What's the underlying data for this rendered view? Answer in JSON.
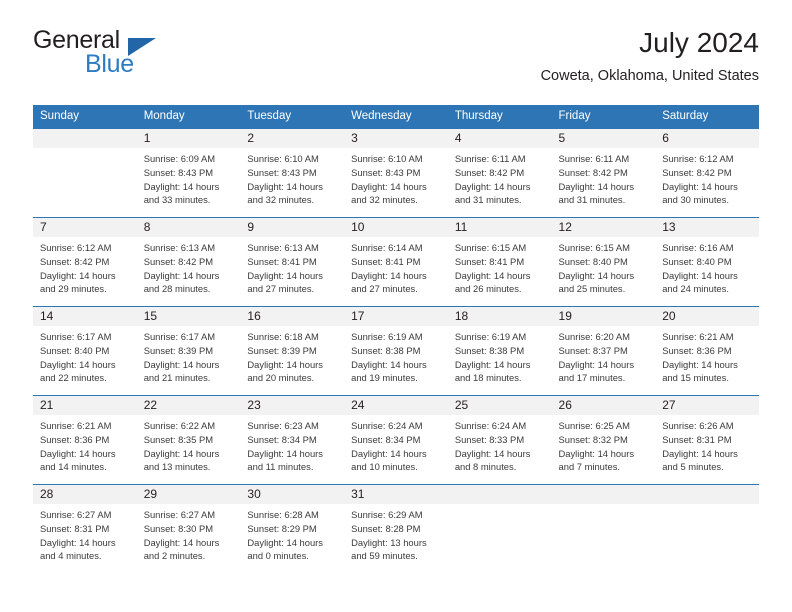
{
  "brand": {
    "name_part1": "General",
    "name_part2": "Blue",
    "triangle_color": "#2266a8",
    "blue_text_color": "#2b7cc2"
  },
  "header": {
    "title": "July 2024",
    "location": "Coweta, Oklahoma, United States"
  },
  "theme": {
    "header_blue": "#2E75B6",
    "daynum_background": "#F2F2F2",
    "text_color": "#231F20"
  },
  "weekday_headers": [
    "Sunday",
    "Monday",
    "Tuesday",
    "Wednesday",
    "Thursday",
    "Friday",
    "Saturday"
  ],
  "labels": {
    "sunrise_prefix": "Sunrise:",
    "sunset_prefix": "Sunset:",
    "daylight_prefix": "Daylight:"
  },
  "weeks": [
    [
      {
        "day": "",
        "sunrise": "",
        "sunset": "",
        "daylight_line1": "",
        "daylight_line2": ""
      },
      {
        "day": "1",
        "sunrise": "Sunrise: 6:09 AM",
        "sunset": "Sunset: 8:43 PM",
        "daylight_line1": "Daylight: 14 hours",
        "daylight_line2": "and 33 minutes."
      },
      {
        "day": "2",
        "sunrise": "Sunrise: 6:10 AM",
        "sunset": "Sunset: 8:43 PM",
        "daylight_line1": "Daylight: 14 hours",
        "daylight_line2": "and 32 minutes."
      },
      {
        "day": "3",
        "sunrise": "Sunrise: 6:10 AM",
        "sunset": "Sunset: 8:43 PM",
        "daylight_line1": "Daylight: 14 hours",
        "daylight_line2": "and 32 minutes."
      },
      {
        "day": "4",
        "sunrise": "Sunrise: 6:11 AM",
        "sunset": "Sunset: 8:42 PM",
        "daylight_line1": "Daylight: 14 hours",
        "daylight_line2": "and 31 minutes."
      },
      {
        "day": "5",
        "sunrise": "Sunrise: 6:11 AM",
        "sunset": "Sunset: 8:42 PM",
        "daylight_line1": "Daylight: 14 hours",
        "daylight_line2": "and 31 minutes."
      },
      {
        "day": "6",
        "sunrise": "Sunrise: 6:12 AM",
        "sunset": "Sunset: 8:42 PM",
        "daylight_line1": "Daylight: 14 hours",
        "daylight_line2": "and 30 minutes."
      }
    ],
    [
      {
        "day": "7",
        "sunrise": "Sunrise: 6:12 AM",
        "sunset": "Sunset: 8:42 PM",
        "daylight_line1": "Daylight: 14 hours",
        "daylight_line2": "and 29 minutes."
      },
      {
        "day": "8",
        "sunrise": "Sunrise: 6:13 AM",
        "sunset": "Sunset: 8:42 PM",
        "daylight_line1": "Daylight: 14 hours",
        "daylight_line2": "and 28 minutes."
      },
      {
        "day": "9",
        "sunrise": "Sunrise: 6:13 AM",
        "sunset": "Sunset: 8:41 PM",
        "daylight_line1": "Daylight: 14 hours",
        "daylight_line2": "and 27 minutes."
      },
      {
        "day": "10",
        "sunrise": "Sunrise: 6:14 AM",
        "sunset": "Sunset: 8:41 PM",
        "daylight_line1": "Daylight: 14 hours",
        "daylight_line2": "and 27 minutes."
      },
      {
        "day": "11",
        "sunrise": "Sunrise: 6:15 AM",
        "sunset": "Sunset: 8:41 PM",
        "daylight_line1": "Daylight: 14 hours",
        "daylight_line2": "and 26 minutes."
      },
      {
        "day": "12",
        "sunrise": "Sunrise: 6:15 AM",
        "sunset": "Sunset: 8:40 PM",
        "daylight_line1": "Daylight: 14 hours",
        "daylight_line2": "and 25 minutes."
      },
      {
        "day": "13",
        "sunrise": "Sunrise: 6:16 AM",
        "sunset": "Sunset: 8:40 PM",
        "daylight_line1": "Daylight: 14 hours",
        "daylight_line2": "and 24 minutes."
      }
    ],
    [
      {
        "day": "14",
        "sunrise": "Sunrise: 6:17 AM",
        "sunset": "Sunset: 8:40 PM",
        "daylight_line1": "Daylight: 14 hours",
        "daylight_line2": "and 22 minutes."
      },
      {
        "day": "15",
        "sunrise": "Sunrise: 6:17 AM",
        "sunset": "Sunset: 8:39 PM",
        "daylight_line1": "Daylight: 14 hours",
        "daylight_line2": "and 21 minutes."
      },
      {
        "day": "16",
        "sunrise": "Sunrise: 6:18 AM",
        "sunset": "Sunset: 8:39 PM",
        "daylight_line1": "Daylight: 14 hours",
        "daylight_line2": "and 20 minutes."
      },
      {
        "day": "17",
        "sunrise": "Sunrise: 6:19 AM",
        "sunset": "Sunset: 8:38 PM",
        "daylight_line1": "Daylight: 14 hours",
        "daylight_line2": "and 19 minutes."
      },
      {
        "day": "18",
        "sunrise": "Sunrise: 6:19 AM",
        "sunset": "Sunset: 8:38 PM",
        "daylight_line1": "Daylight: 14 hours",
        "daylight_line2": "and 18 minutes."
      },
      {
        "day": "19",
        "sunrise": "Sunrise: 6:20 AM",
        "sunset": "Sunset: 8:37 PM",
        "daylight_line1": "Daylight: 14 hours",
        "daylight_line2": "and 17 minutes."
      },
      {
        "day": "20",
        "sunrise": "Sunrise: 6:21 AM",
        "sunset": "Sunset: 8:36 PM",
        "daylight_line1": "Daylight: 14 hours",
        "daylight_line2": "and 15 minutes."
      }
    ],
    [
      {
        "day": "21",
        "sunrise": "Sunrise: 6:21 AM",
        "sunset": "Sunset: 8:36 PM",
        "daylight_line1": "Daylight: 14 hours",
        "daylight_line2": "and 14 minutes."
      },
      {
        "day": "22",
        "sunrise": "Sunrise: 6:22 AM",
        "sunset": "Sunset: 8:35 PM",
        "daylight_line1": "Daylight: 14 hours",
        "daylight_line2": "and 13 minutes."
      },
      {
        "day": "23",
        "sunrise": "Sunrise: 6:23 AM",
        "sunset": "Sunset: 8:34 PM",
        "daylight_line1": "Daylight: 14 hours",
        "daylight_line2": "and 11 minutes."
      },
      {
        "day": "24",
        "sunrise": "Sunrise: 6:24 AM",
        "sunset": "Sunset: 8:34 PM",
        "daylight_line1": "Daylight: 14 hours",
        "daylight_line2": "and 10 minutes."
      },
      {
        "day": "25",
        "sunrise": "Sunrise: 6:24 AM",
        "sunset": "Sunset: 8:33 PM",
        "daylight_line1": "Daylight: 14 hours",
        "daylight_line2": "and 8 minutes."
      },
      {
        "day": "26",
        "sunrise": "Sunrise: 6:25 AM",
        "sunset": "Sunset: 8:32 PM",
        "daylight_line1": "Daylight: 14 hours",
        "daylight_line2": "and 7 minutes."
      },
      {
        "day": "27",
        "sunrise": "Sunrise: 6:26 AM",
        "sunset": "Sunset: 8:31 PM",
        "daylight_line1": "Daylight: 14 hours",
        "daylight_line2": "and 5 minutes."
      }
    ],
    [
      {
        "day": "28",
        "sunrise": "Sunrise: 6:27 AM",
        "sunset": "Sunset: 8:31 PM",
        "daylight_line1": "Daylight: 14 hours",
        "daylight_line2": "and 4 minutes."
      },
      {
        "day": "29",
        "sunrise": "Sunrise: 6:27 AM",
        "sunset": "Sunset: 8:30 PM",
        "daylight_line1": "Daylight: 14 hours",
        "daylight_line2": "and 2 minutes."
      },
      {
        "day": "30",
        "sunrise": "Sunrise: 6:28 AM",
        "sunset": "Sunset: 8:29 PM",
        "daylight_line1": "Daylight: 14 hours",
        "daylight_line2": "and 0 minutes."
      },
      {
        "day": "31",
        "sunrise": "Sunrise: 6:29 AM",
        "sunset": "Sunset: 8:28 PM",
        "daylight_line1": "Daylight: 13 hours",
        "daylight_line2": "and 59 minutes."
      },
      {
        "day": "",
        "sunrise": "",
        "sunset": "",
        "daylight_line1": "",
        "daylight_line2": ""
      },
      {
        "day": "",
        "sunrise": "",
        "sunset": "",
        "daylight_line1": "",
        "daylight_line2": ""
      },
      {
        "day": "",
        "sunrise": "",
        "sunset": "",
        "daylight_line1": "",
        "daylight_line2": ""
      }
    ]
  ]
}
